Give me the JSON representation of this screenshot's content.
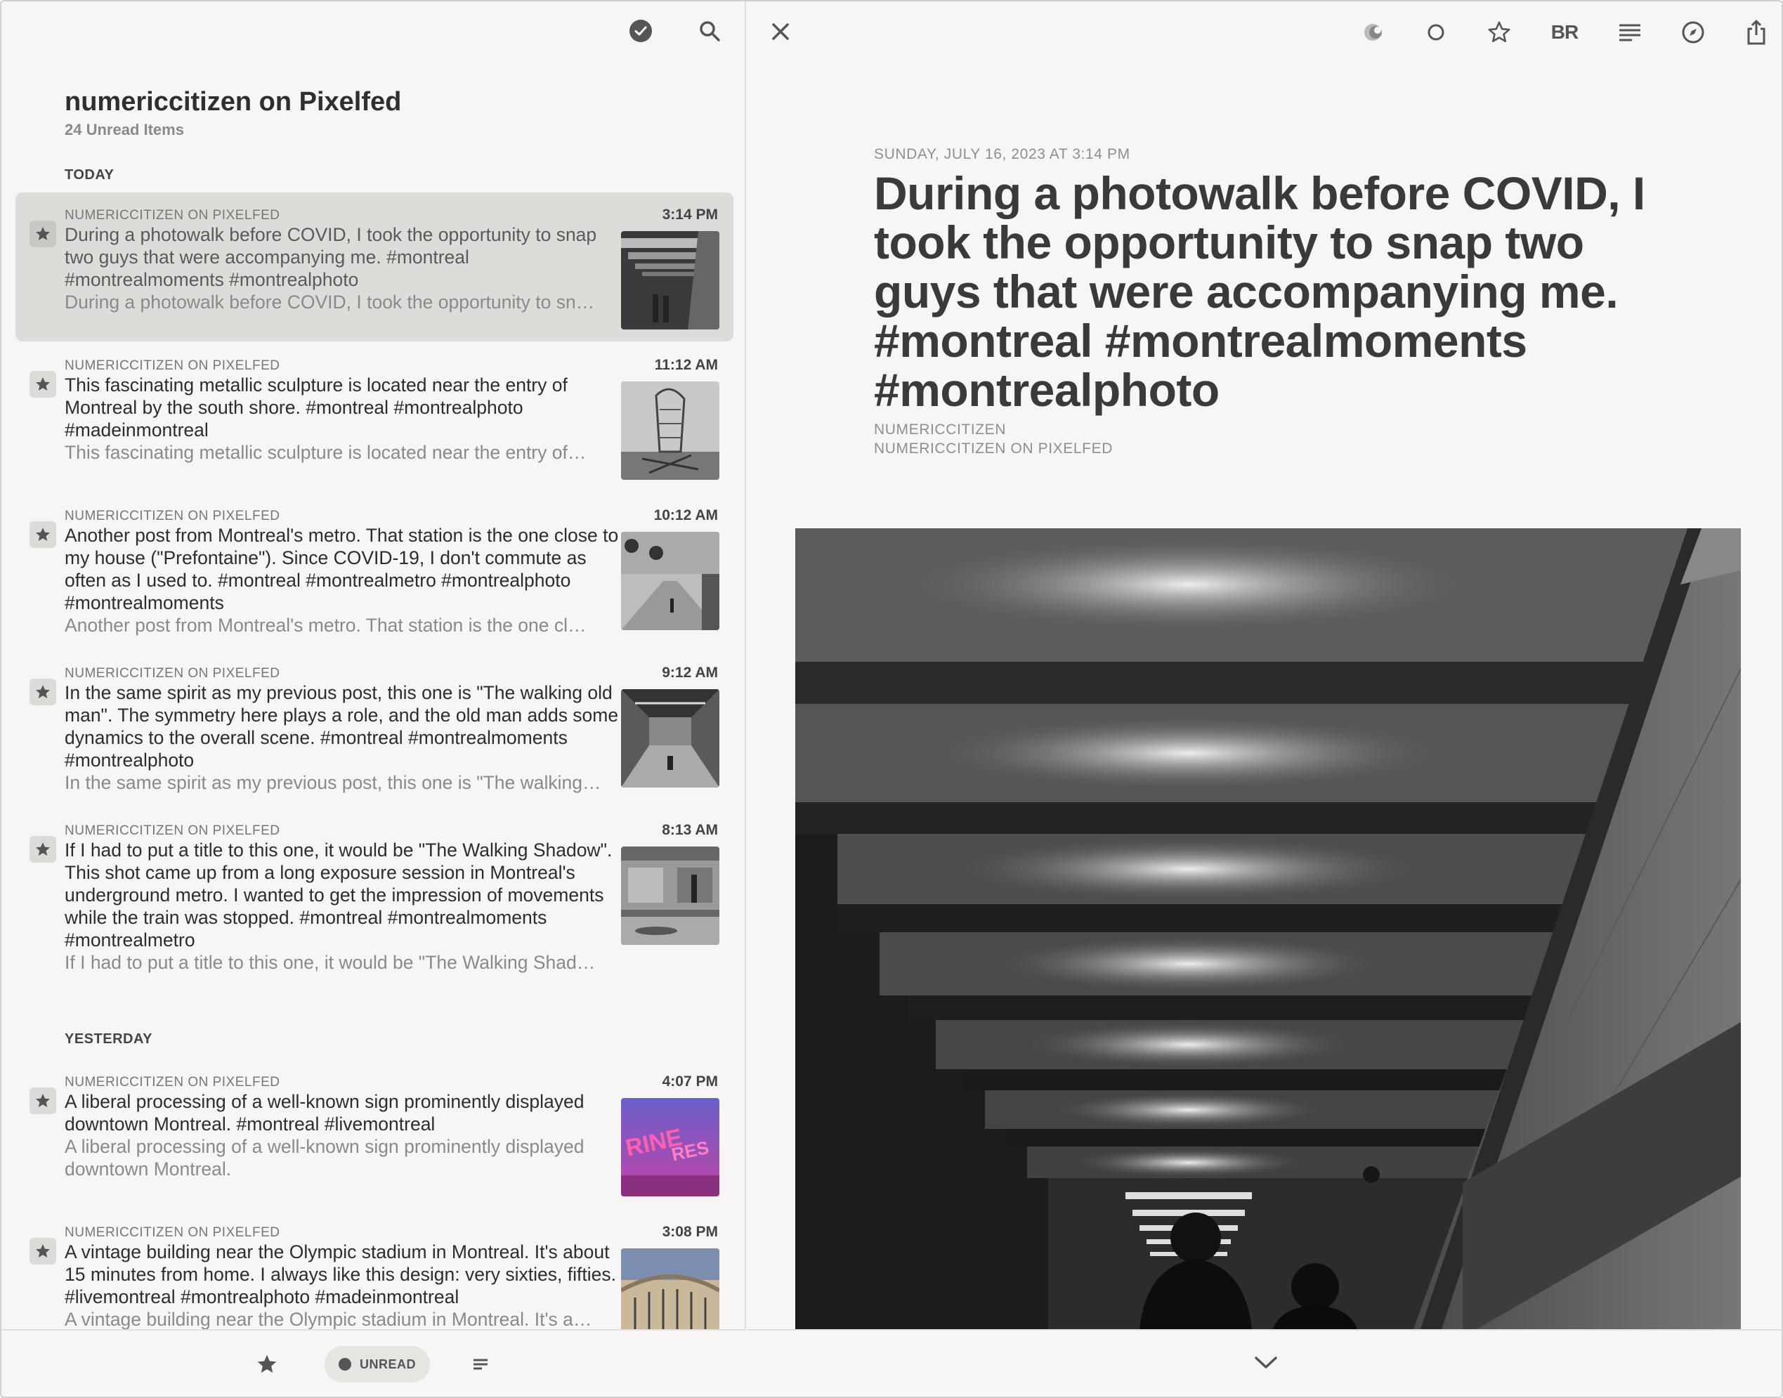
{
  "feed": {
    "title": "numericcitizen on Pixelfed",
    "unread_count": "24 Unread Items"
  },
  "sections": {
    "today": "TODAY",
    "yesterday": "YESTERDAY"
  },
  "items": [
    {
      "source": "NUMERICCITIZEN ON PIXELFED",
      "time": "3:14 PM",
      "title": "During a photowalk before COVID, I took the opportunity to snap two guys that were accompanying me. #montreal #montrealmoments #montrealphoto",
      "summary": "During a photowalk before COVID, I took the opportunity to sn…",
      "selected": true
    },
    {
      "source": "NUMERICCITIZEN ON PIXELFED",
      "time": "11:12 AM",
      "title": "This fascinating metallic sculpture is located near the entry of Montreal by the south shore. #montreal #montrealphoto #madeinmontreal",
      "summary": "This fascinating metallic sculpture is located near the entry of…"
    },
    {
      "source": "NUMERICCITIZEN ON PIXELFED",
      "time": "10:12 AM",
      "title": "Another post from Montreal's metro. That station is the one close to my house (\"Prefontaine\"). Since COVID-19, I don't commute as often as I used to. #montreal #montrealmetro #montrealphoto #montrealmoments",
      "summary": "Another post from Montreal's metro. That station is the one cl…"
    },
    {
      "source": "NUMERICCITIZEN ON PIXELFED",
      "time": "9:12 AM",
      "title": "In the same spirit as my previous post, this one is \"The walking old man\". The symmetry here plays a role, and the old man adds some dynamics to the overall scene. #montreal #montrealmoments #montrealphoto",
      "summary": "In the same spirit as my previous post, this one is \"The walking…"
    },
    {
      "source": "NUMERICCITIZEN ON PIXELFED",
      "time": "8:13 AM",
      "title": "If I had to put a title to this one, it would be \"The Walking Shadow\". This shot came up from a long exposure session in Montreal's underground metro. I wanted to get the impression of movements while the train was stopped. #montreal #montrealmoments #montrealmetro",
      "summary": "If I had to put a title to this one, it would be \"The Walking Shad…"
    },
    {
      "source": "NUMERICCITIZEN ON PIXELFED",
      "time": "4:07 PM",
      "title": "A liberal processing of a well-known sign prominently displayed downtown Montreal. #montreal #livemontreal",
      "summary": "A liberal processing of a well-known sign prominently displayed downtown Montreal."
    },
    {
      "source": "NUMERICCITIZEN ON PIXELFED",
      "time": "3:08 PM",
      "title": "A vintage building near the Olympic stadium in Montreal. It's about 15 minutes from home. I always like this design: very sixties, fifties. #livemontreal #montrealphoto #madeinmontreal",
      "summary": "A vintage building near the Olympic stadium in Montreal. It's a…"
    }
  ],
  "bottom_bar": {
    "unread_label": "UNREAD"
  },
  "article": {
    "date": "SUNDAY, JULY 16, 2023 AT 3:14 PM",
    "title": "During a photowalk before COVID, I took the opportunity to snap two guys that were accompanying me. #montreal #montrealmoments #montrealphoto",
    "author": "NUMERICCITIZEN",
    "feed": "NUMERICCITIZEN ON PIXELFED"
  },
  "toolbar": {
    "reader_label": "BR"
  },
  "icons": {
    "mark_all_read": "checkmark-circle-icon",
    "search": "search-icon",
    "close": "close-icon",
    "feed_favicon": "feed-favicon-icon",
    "unread_toggle": "circle-icon",
    "star": "star-icon",
    "reader_view": "reader-view-icon",
    "open_browser": "compass-icon",
    "share": "share-icon",
    "next": "chevron-down-icon"
  }
}
